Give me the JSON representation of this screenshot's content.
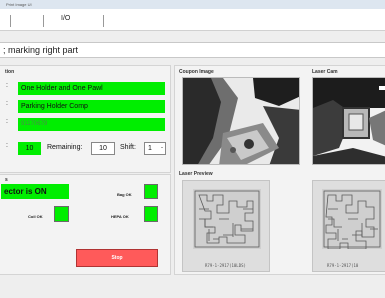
{
  "window": {
    "title": "Print Image UI"
  },
  "menu": {
    "io_label": "I/O"
  },
  "status_text": "; marking right part",
  "left_panel": {
    "title": "tion",
    "part_name": "One Holder and One Pawl",
    "part_desc": "Parking Holder Comp",
    "part_number": "91170679",
    "count_value": "10",
    "remaining_label": "Remaining:",
    "remaining_value": "10",
    "shift_label": "Shift:",
    "shift_value": "1"
  },
  "status_panel": {
    "title": "s",
    "laser_status": "ector is ON",
    "bag_label": "Bag OK",
    "coil_label": "Coil OK",
    "hepa_label": "HEPA OK",
    "stop_label": "Stop"
  },
  "images": {
    "coupon_title": "Coupon Image",
    "laser_cam_title": "Laser Cam",
    "preview_title": "Laser Preview",
    "preview_caption_1": "R79-1-2917(10LDS)",
    "preview_caption_2": "R79-1-2917(10"
  },
  "colors": {
    "ok_green": "#00ee00",
    "stop_red": "#ff5a5a",
    "header_blue": "#dde6f0"
  },
  "icons": {
    "shift_spinner": "spinner-arrows-icon",
    "barcode": "data-matrix-icon"
  }
}
